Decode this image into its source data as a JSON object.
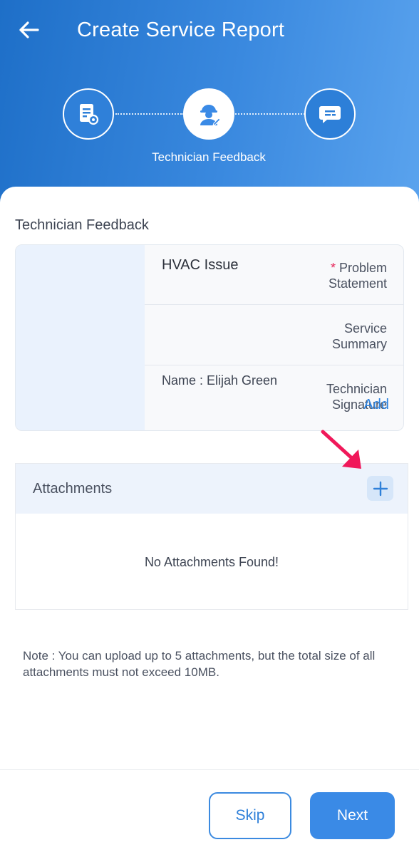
{
  "header": {
    "title": "Create Service Report",
    "back_icon": "arrow-left-icon",
    "bg_gradient": [
      "#1e6fc8",
      "#5aa3ee"
    ]
  },
  "stepper": {
    "steps": [
      {
        "icon": "document-settings-icon",
        "state": "done"
      },
      {
        "icon": "technician-helmet-icon",
        "state": "active",
        "label": "Technician Feedback"
      },
      {
        "icon": "chat-message-icon",
        "state": "pending"
      }
    ]
  },
  "feedback": {
    "section_title": "Technician Feedback",
    "required_mark": "*",
    "rows": [
      {
        "label_line1": "Problem",
        "label_line2": "Statement",
        "value": "HVAC Issue"
      },
      {
        "label_line1": "Service",
        "label_line2": "Summary",
        "value": ""
      },
      {
        "label_line1": "Technician",
        "label_line2": "Signature",
        "value": "Name : Elijah Green",
        "action": "Add"
      }
    ]
  },
  "attachments": {
    "title": "Attachments",
    "add_icon": "plus-icon",
    "empty_text": "No Attachments Found!"
  },
  "note": "Note : You can upload up to 5 attachments, but the total size of all attachments must not exceed 10MB.",
  "footer": {
    "skip_label": "Skip",
    "next_label": "Next"
  },
  "colors": {
    "accent": "#3a8ae6",
    "required": "#e6275a",
    "annotation_arrow": "#f0185a"
  }
}
